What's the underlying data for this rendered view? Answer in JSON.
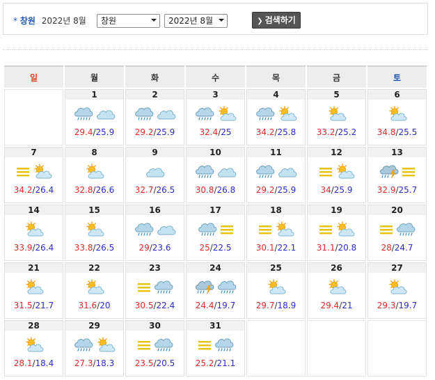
{
  "header": {
    "star": "*",
    "city": "창원",
    "date": "2022년 8월",
    "region_select": "창원",
    "month_select": "2022년 8월",
    "search_label": "검색하기"
  },
  "weekdays": [
    "일",
    "월",
    "화",
    "수",
    "목",
    "금",
    "토"
  ],
  "weeks": [
    [
      null,
      {
        "day": "1",
        "icons": [
          "rain-cloud-icon",
          "cloud-icon"
        ],
        "max": "29.4",
        "min": "25.9"
      },
      {
        "day": "2",
        "icons": [
          "rain-cloud-icon",
          "cloud-icon"
        ],
        "max": "29.2",
        "min": "25.9"
      },
      {
        "day": "3",
        "icons": [
          "rain-cloud-icon",
          "sun-cloud-icon"
        ],
        "max": "32.4",
        "min": "25"
      },
      {
        "day": "4",
        "icons": [
          "rain-cloud-icon",
          "sun-cloud-icon"
        ],
        "max": "34.2",
        "min": "25.8"
      },
      {
        "day": "5",
        "icons": [
          "sun-cloud-icon"
        ],
        "max": "33.2",
        "min": "25.2"
      },
      {
        "day": "6",
        "icons": [
          "sun-cloud-icon"
        ],
        "max": "34.8",
        "min": "25.5"
      }
    ],
    [
      {
        "day": "7",
        "icons": [
          "haze-icon",
          "sun-cloud-icon"
        ],
        "max": "34.2",
        "min": "26.4"
      },
      {
        "day": "8",
        "icons": [
          "sun-cloud-icon"
        ],
        "max": "32.8",
        "min": "26.6"
      },
      {
        "day": "9",
        "icons": [
          "cloud-icon"
        ],
        "max": "32.7",
        "min": "26.5"
      },
      {
        "day": "10",
        "icons": [
          "rain-cloud-icon",
          "cloud-icon"
        ],
        "max": "30.8",
        "min": "26.8"
      },
      {
        "day": "11",
        "icons": [
          "rain-cloud-icon",
          "cloud-icon"
        ],
        "max": "29.2",
        "min": "25.9"
      },
      {
        "day": "12",
        "icons": [
          "haze-icon",
          "sun-cloud-icon"
        ],
        "max": "34",
        "min": "25.9"
      },
      {
        "day": "13",
        "icons": [
          "thunder-rain-icon",
          "haze-icon"
        ],
        "max": "32.9",
        "min": "25.7"
      }
    ],
    [
      {
        "day": "14",
        "icons": [
          "sun-cloud-icon"
        ],
        "max": "33.9",
        "min": "26.4"
      },
      {
        "day": "15",
        "icons": [
          "sun-cloud-icon"
        ],
        "max": "33.8",
        "min": "26.5"
      },
      {
        "day": "16",
        "icons": [
          "rain-cloud-icon",
          "cloud-icon"
        ],
        "max": "29",
        "min": "23.6"
      },
      {
        "day": "17",
        "icons": [
          "rain-cloud-icon",
          "haze-icon"
        ],
        "max": "25",
        "min": "22.5"
      },
      {
        "day": "18",
        "icons": [
          "haze-icon",
          "sun-cloud-icon"
        ],
        "max": "30.1",
        "min": "22.1"
      },
      {
        "day": "19",
        "icons": [
          "haze-icon",
          "sun-cloud-icon"
        ],
        "max": "31.1",
        "min": "20.8"
      },
      {
        "day": "20",
        "icons": [
          "haze-icon",
          "rain-cloud-icon"
        ],
        "max": "28",
        "min": "24.7"
      }
    ],
    [
      {
        "day": "21",
        "icons": [
          "sun-cloud-icon"
        ],
        "max": "31.5",
        "min": "21.7"
      },
      {
        "day": "22",
        "icons": [
          "sun-cloud-icon"
        ],
        "max": "31.6",
        "min": "20"
      },
      {
        "day": "23",
        "icons": [
          "haze-icon",
          "rain-cloud-icon"
        ],
        "max": "30.5",
        "min": "22.4"
      },
      {
        "day": "24",
        "icons": [
          "thunder-rain-icon",
          "rain-cloud-icon"
        ],
        "max": "24.4",
        "min": "19.7"
      },
      {
        "day": "25",
        "icons": [
          "sun-cloud-icon"
        ],
        "max": "29.7",
        "min": "18.9"
      },
      {
        "day": "26",
        "icons": [
          "sun-cloud-icon"
        ],
        "max": "29.4",
        "min": "21"
      },
      {
        "day": "27",
        "icons": [
          "sun-cloud-icon"
        ],
        "max": "29.3",
        "min": "19.7"
      }
    ],
    [
      {
        "day": "28",
        "icons": [
          "sun-cloud-icon"
        ],
        "max": "28.1",
        "min": "18.4"
      },
      {
        "day": "29",
        "icons": [
          "rain-cloud-icon",
          "sun-cloud-icon"
        ],
        "max": "27.3",
        "min": "18.3"
      },
      {
        "day": "30",
        "icons": [
          "haze-icon",
          "rain-cloud-icon"
        ],
        "max": "23.5",
        "min": "20.5"
      },
      {
        "day": "31",
        "icons": [
          "haze-icon",
          "rain-cloud-icon"
        ],
        "max": "25.2",
        "min": "21.1"
      },
      null,
      null,
      null
    ]
  ],
  "colors": {
    "max_temp": "#e02b2b",
    "min_temp": "#2b2bd0",
    "sunday": "#e0421e",
    "saturday": "#1d4fa8",
    "accent": "#1f56b5",
    "button": "#555555"
  }
}
